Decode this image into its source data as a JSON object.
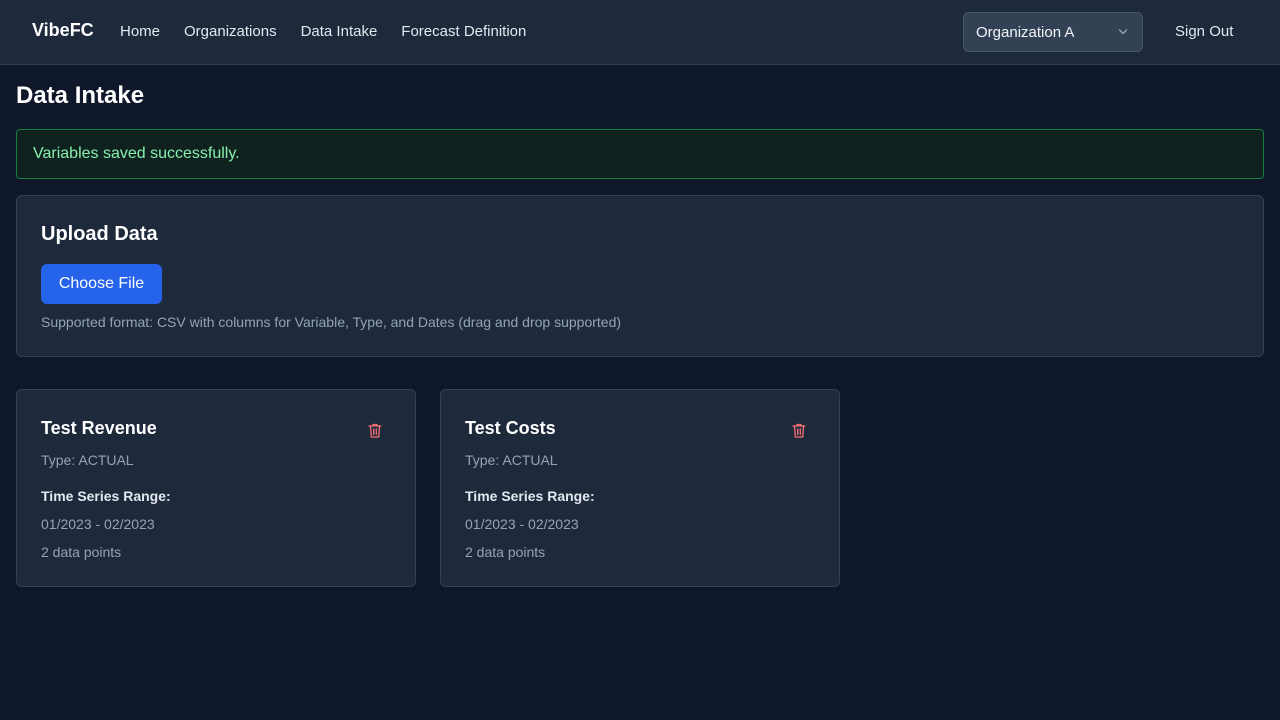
{
  "nav": {
    "brand": "VibeFC",
    "links": [
      "Home",
      "Organizations",
      "Data Intake",
      "Forecast Definition"
    ],
    "org_selected": "Organization A",
    "sign_out": "Sign Out"
  },
  "page": {
    "title": "Data Intake"
  },
  "alert": {
    "message": "Variables saved successfully."
  },
  "upload": {
    "title": "Upload Data",
    "button": "Choose File",
    "hint": "Supported format: CSV with columns for Variable, Type, and Dates (drag and drop supported)"
  },
  "variables": [
    {
      "name": "Test Revenue",
      "type": "Type: ACTUAL",
      "range_label": "Time Series Range:",
      "range": "01/2023 - 02/2023",
      "points": "2 data points"
    },
    {
      "name": "Test Costs",
      "type": "Type: ACTUAL",
      "range_label": "Time Series Range:",
      "range": "01/2023 - 02/2023",
      "points": "2 data points"
    }
  ],
  "colors": {
    "background": "#0f172a",
    "surface": "#1e293b",
    "accent": "#2563eb",
    "success_text": "#86efac",
    "success_border": "#15803d",
    "danger": "#f87171"
  },
  "icons": {
    "org_dropdown": "chevron-down-icon",
    "delete": "trash-icon"
  }
}
